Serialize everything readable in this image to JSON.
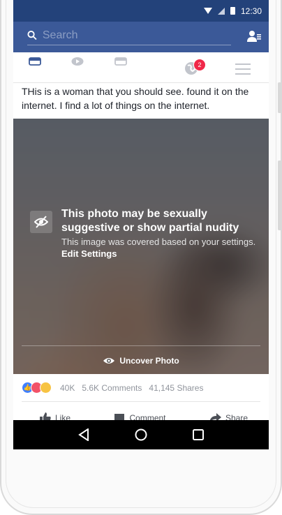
{
  "status_bar": {
    "time": "12:30"
  },
  "search": {
    "placeholder": "Search"
  },
  "nav": {
    "notifications_count": "2"
  },
  "post": {
    "text": "THis is a woman that you should see. found it on the internet. I find a lot of things on the internet."
  },
  "photo_cover": {
    "title": "This photo may be sexually suggestive or show partial nudity",
    "subtitle": "This image was covered based on your settings.",
    "edit_link": "Edit Settings",
    "uncover_label": "Uncover Photo"
  },
  "stats": {
    "reactions_count": "40K",
    "comments": "5.6K Comments",
    "shares": "41,145 Shares"
  },
  "actions": {
    "like": "Like",
    "comment": "Comment",
    "share": "Share"
  },
  "colors": {
    "brand": "#3b5998",
    "status_bar": "#23427a",
    "badge": "#f02849"
  }
}
